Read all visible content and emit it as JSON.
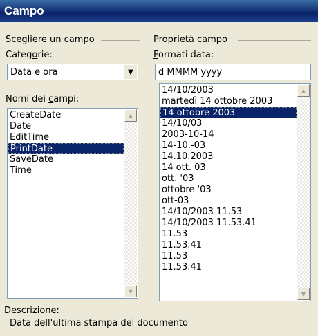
{
  "window": {
    "title": "Campo"
  },
  "left_group": {
    "header": "Scegliere un campo",
    "category_label_pre": "Categ",
    "category_label_ul": "o",
    "category_label_post": "rie:",
    "category_value": "Data e ora",
    "fields_label_pre": "Nomi dei ",
    "fields_label_ul": "c",
    "fields_label_post": "ampi:",
    "fields": [
      "CreateDate",
      "Date",
      "EditTime",
      "PrintDate",
      "SaveDate",
      "Time"
    ],
    "selected_field": "PrintDate"
  },
  "right_group": {
    "header": "Proprietà campo",
    "formats_label_ul": "F",
    "formats_label_post": "ormati data:",
    "format_value": "d MMMM yyyy",
    "formats": [
      "14/10/2003",
      "martedì 14 ottobre 2003",
      "14 ottobre 2003",
      "14/10/03",
      "2003-10-14",
      "14-10.-03",
      "14.10.2003",
      "14 ott. 03",
      "ott. '03",
      "ottobre '03",
      "ott-03",
      "14/10/2003 11.53",
      "14/10/2003 11.53.41",
      "11.53",
      "11.53.41",
      "11.53",
      "11.53.41"
    ],
    "selected_format": "14 ottobre 2003"
  },
  "description": {
    "label": "Descrizione:",
    "text": "Data dell'ultima stampa del documento"
  },
  "colors": {
    "selection": "#0a246a",
    "titlebar": "#0a246a"
  }
}
